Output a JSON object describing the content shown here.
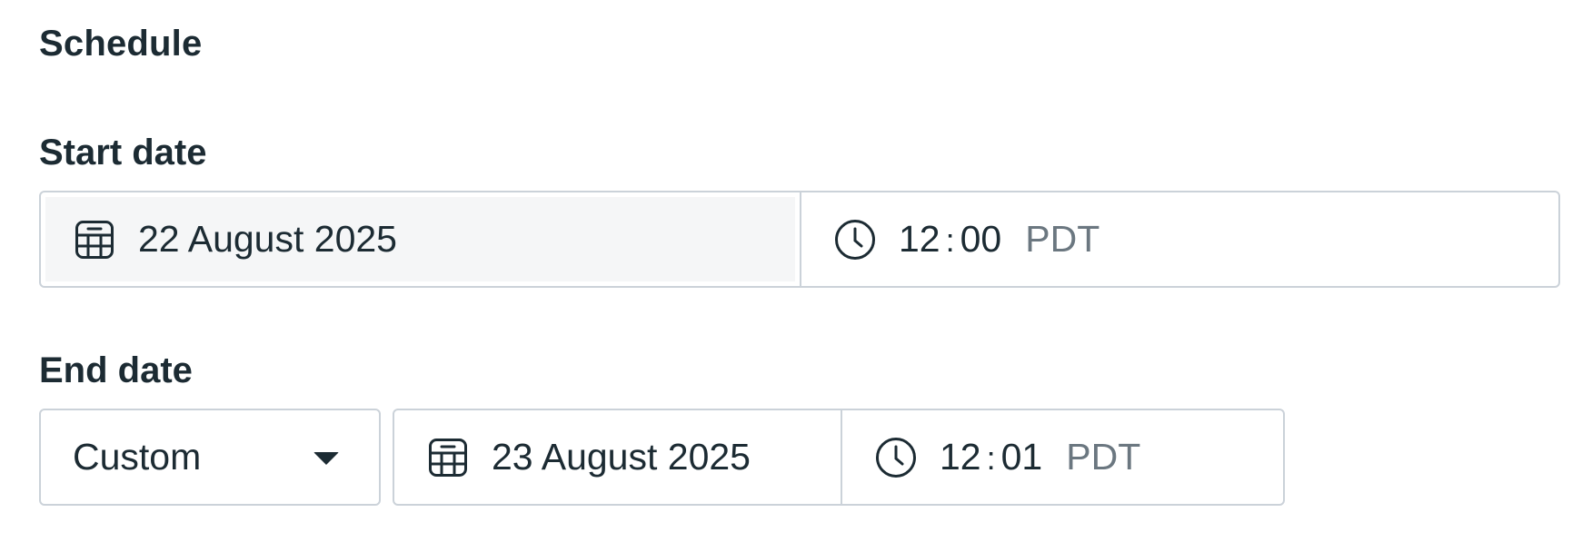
{
  "schedule": {
    "title": "Schedule",
    "start": {
      "label": "Start date",
      "date": "22 August 2025",
      "time_hour": "12",
      "time_separator": ":",
      "time_minute": "00",
      "timezone": "PDT"
    },
    "end": {
      "label": "End date",
      "mode": "Custom",
      "date": "23 August 2025",
      "time_hour": "12",
      "time_separator": ":",
      "time_minute": "01",
      "timezone": "PDT"
    }
  },
  "icons": {
    "date": "calendar-icon",
    "time": "clock-icon",
    "dropdown": "caret-down-icon"
  },
  "colors": {
    "text": "#1c2b33",
    "muted": "#6b7780",
    "border": "#cbd2d9",
    "highlight": "#f5f6f7"
  }
}
